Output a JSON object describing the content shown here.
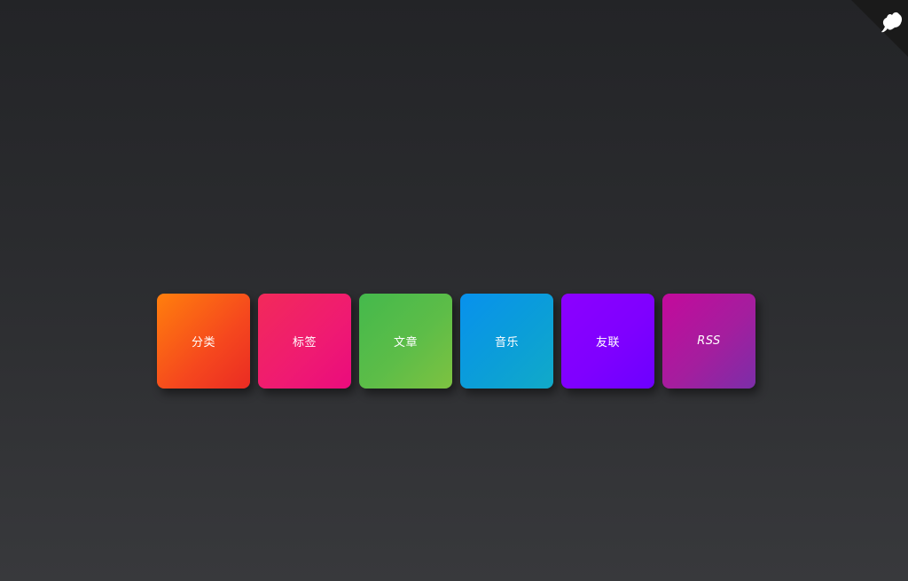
{
  "corner": {
    "icon": "github-cat-icon",
    "background": "#1a1a1a",
    "icon_color": "#ffffff"
  },
  "tiles": [
    {
      "label": "分类",
      "colors": [
        "#ff7f0d",
        "#ea2b23"
      ]
    },
    {
      "label": "标签",
      "colors": [
        "#f22a5a",
        "#ea0b7d"
      ]
    },
    {
      "label": "文章",
      "colors": [
        "#44b94c",
        "#7ec241"
      ]
    },
    {
      "label": "音乐",
      "colors": [
        "#0891ed",
        "#11aac8"
      ]
    },
    {
      "label": "友联",
      "colors": [
        "#8c00ff",
        "#6c00ff"
      ]
    },
    {
      "label": "RSS",
      "colors": [
        "#c40a9c",
        "#7b2ea8"
      ]
    }
  ]
}
